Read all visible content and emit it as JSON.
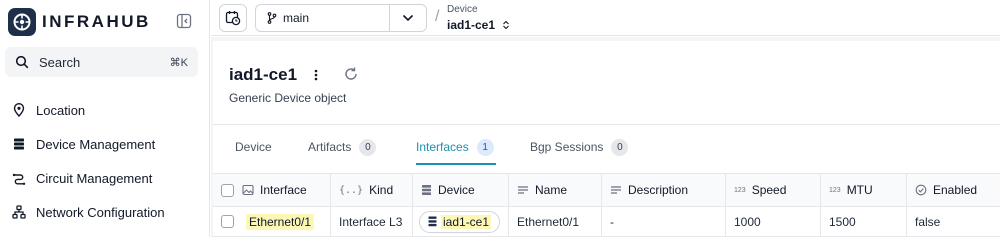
{
  "app": {
    "name": "INFRAHUB",
    "search": {
      "label": "Search",
      "shortcut": "⌘K"
    },
    "nav": [
      {
        "label": "Location",
        "icon": "location-pin-icon"
      },
      {
        "label": "Device Management",
        "icon": "server-stack-icon"
      },
      {
        "label": "Circuit Management",
        "icon": "circuit-icon"
      },
      {
        "label": "Network Configuration",
        "icon": "network-icon"
      }
    ]
  },
  "topbar": {
    "branch": "main",
    "breadcrumb": {
      "kind": "Device",
      "value": "iad1-ce1"
    }
  },
  "page": {
    "title": "iad1-ce1",
    "subtitle": "Generic Device object",
    "tabs": [
      {
        "label": "Device"
      },
      {
        "label": "Artifacts",
        "count": "0"
      },
      {
        "label": "Interfaces",
        "count": "1",
        "active": true
      },
      {
        "label": "Bgp Sessions",
        "count": "0"
      }
    ]
  },
  "table": {
    "columns": [
      "Interface",
      "Kind",
      "Device",
      "Name",
      "Description",
      "Speed",
      "MTU",
      "Enabled"
    ],
    "column_type_badge": "123",
    "rows": [
      {
        "interface": "Ethernet0/1",
        "kind": "Interface L3",
        "device": "iad1-ce1",
        "name": "Ethernet0/1",
        "description": "-",
        "speed": "1000",
        "mtu": "1500",
        "enabled": "false"
      }
    ]
  },
  "colors": {
    "accent": "#1d8fb0",
    "highlight": "#fdf7b5",
    "logo_bg": "#1f2f4a"
  }
}
